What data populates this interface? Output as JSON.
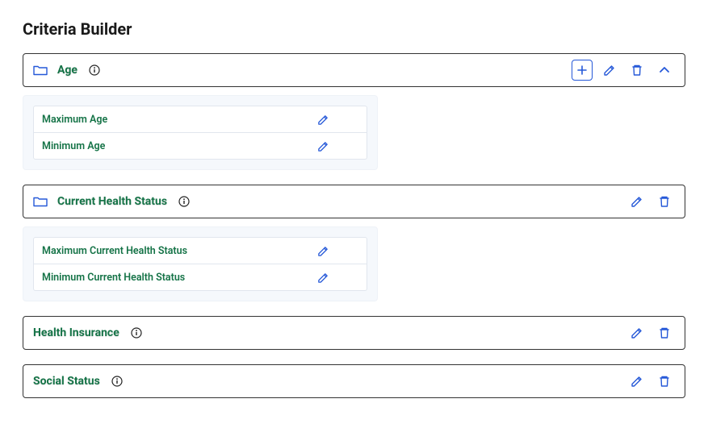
{
  "page": {
    "title": "Criteria Builder"
  },
  "criteria": [
    {
      "title": "Age",
      "hasFolder": true,
      "hasInfo": true,
      "hasAdd": true,
      "hasEdit": true,
      "hasDelete": true,
      "hasChevron": true,
      "subitems": [
        {
          "label": "Maximum Age"
        },
        {
          "label": "Minimum Age"
        }
      ]
    },
    {
      "title": "Current Health Status",
      "hasFolder": true,
      "hasInfo": true,
      "hasAdd": false,
      "hasEdit": true,
      "hasDelete": true,
      "hasChevron": false,
      "subitems": [
        {
          "label": "Maximum Current Health Status"
        },
        {
          "label": "Minimum Current Health Status"
        }
      ]
    },
    {
      "title": "Health Insurance",
      "hasFolder": false,
      "hasInfo": true,
      "hasAdd": false,
      "hasEdit": true,
      "hasDelete": true,
      "hasChevron": false,
      "subitems": []
    },
    {
      "title": "Social Status",
      "hasFolder": false,
      "hasInfo": true,
      "hasAdd": false,
      "hasEdit": true,
      "hasDelete": true,
      "hasChevron": false,
      "subitems": []
    }
  ],
  "colors": {
    "accent": "#2558d8",
    "titleGreen": "#157347"
  }
}
